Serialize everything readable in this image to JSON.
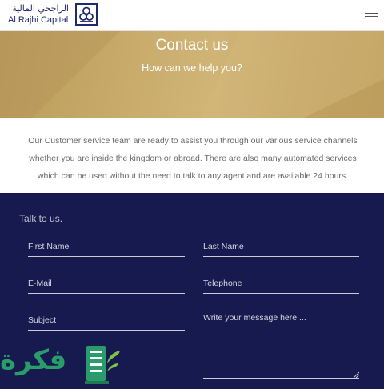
{
  "header": {
    "brand_ar": "الراجحي المالية",
    "brand_en": "Al Rajhi Capital",
    "logo_icon": "al-rajhi-logo-icon",
    "menu_icon": "hamburger-menu-icon"
  },
  "hero": {
    "title": "Contact us",
    "subtitle": "How can we help you?"
  },
  "intro": {
    "text": "Our Customer service team are ready to assist you through our various service channels whether you are inside the kingdom or abroad. There are also many automated services which can be used without the need to talk to any agent and are available 24 hours."
  },
  "form": {
    "title": "Talk to us.",
    "first_name_placeholder": "First Name",
    "last_name_placeholder": "Last Name",
    "email_placeholder": "E-Mail",
    "telephone_placeholder": "Telephone",
    "subject_placeholder": "Subject",
    "message_placeholder": "Write your message here ..."
  },
  "watermark": {
    "text": "فكرة"
  },
  "colors": {
    "brand_navy": "#1f2a6b",
    "hero_gold": "#c9ac6c",
    "form_bg": "#161a4e",
    "watermark_green": "#2a9b6a"
  }
}
